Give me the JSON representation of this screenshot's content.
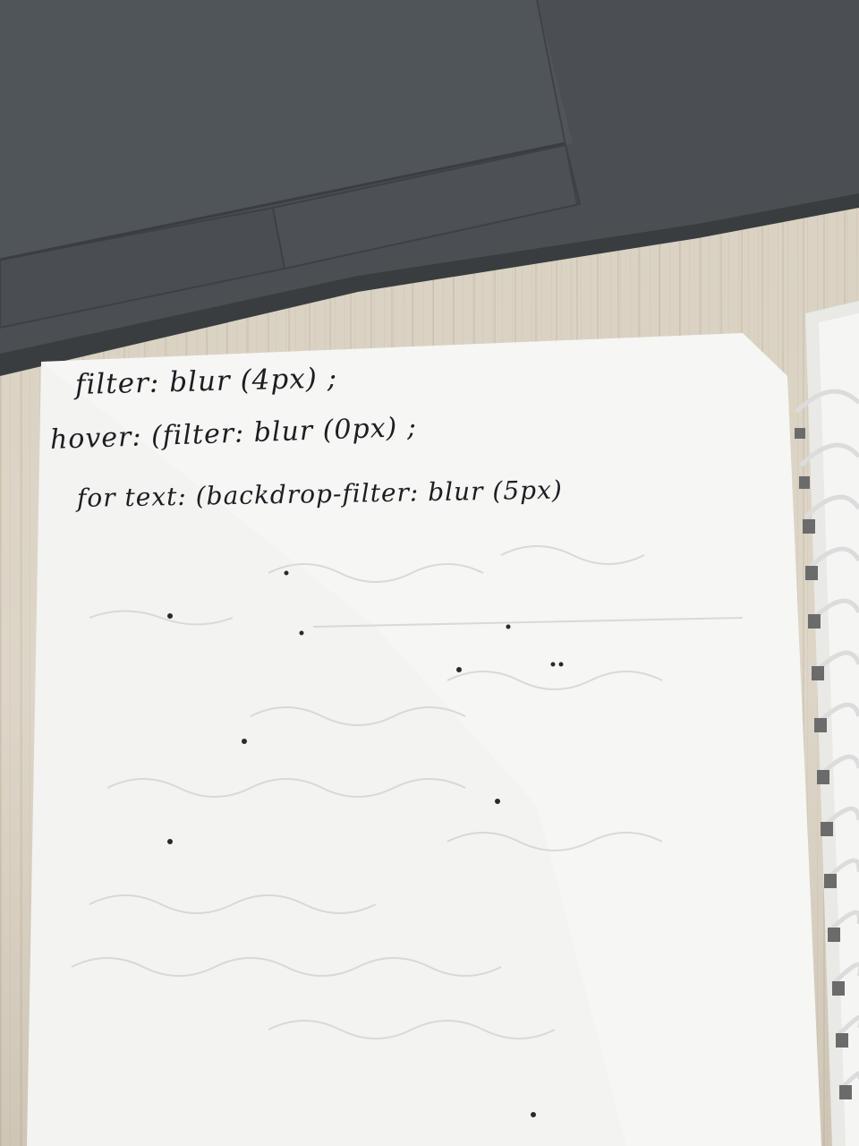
{
  "notebook": {
    "lines": [
      "filter: blur (4px) ;",
      "hover: (filter: blur (0px) ;",
      "for text: (backdrop-filter: blur (5px)"
    ]
  },
  "colors": {
    "laptop": "#4a4e52",
    "paper": "#f3f3f1",
    "ink": "#1d1d22",
    "desk": "#d9d2c4"
  }
}
